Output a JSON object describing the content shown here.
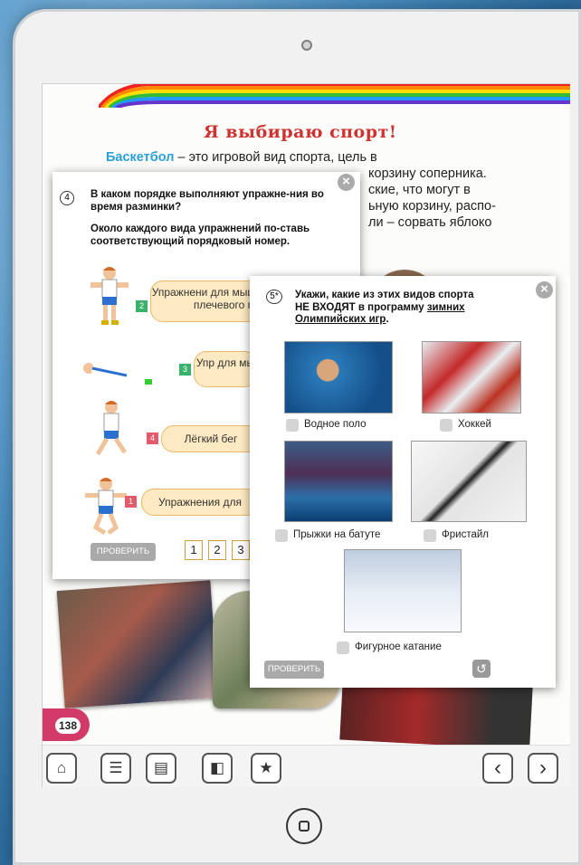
{
  "page": {
    "title": "Я выбираю спорт!",
    "intro_term": "Баскетбол",
    "intro_line1": " – это игровой вид спорта, цель в",
    "intro_line2": "корзину соперника.",
    "intro_line3": "ские, что могут в",
    "intro_line4": "ьную корзину, распо-",
    "intro_line5": "ли – сорвать яблоко",
    "page_number": "138"
  },
  "exercise4": {
    "number": "4",
    "question": "В каком порядке выполняют упражне-ния во время разминки?",
    "instruction": "Около каждого вида упражнений по-ставь соответствующий порядковый номер.",
    "items": [
      {
        "num": "2",
        "label": "Упражнени для мышц шеи и плечевого п",
        "color": "#3ab26b"
      },
      {
        "num": "3",
        "label": "Упр для мы",
        "color": "#3ab26b"
      },
      {
        "num": "4",
        "label": "Лёгкий бег",
        "color": "#e35a6a"
      },
      {
        "num": "1",
        "label": "Упражнения для",
        "color": "#e35a6a"
      }
    ],
    "check_label": "ПРОВЕРИТЬ",
    "options": [
      "1",
      "2",
      "3"
    ]
  },
  "exercise5": {
    "number": "5*",
    "question_part1": "Укажи, какие из этих видов спорта",
    "question_part2": "НЕ ВХОДЯТ в программу",
    "question_underlined": "зимних Олимпийских игр",
    "question_end": ".",
    "options": [
      {
        "label": "Водное поло"
      },
      {
        "label": "Хоккей"
      },
      {
        "label": "Прыжки на батуте"
      },
      {
        "label": "Фристайл"
      },
      {
        "label": "Фигурное катание"
      }
    ],
    "check_label": "ПРОВЕРИТЬ"
  },
  "toolbar": {
    "home_icon": "⌂",
    "list_icon": "☰",
    "doc_icon": "▤",
    "bookmark_icon": "◧",
    "star_icon": "★",
    "prev_icon": "‹",
    "next_icon": "›"
  }
}
